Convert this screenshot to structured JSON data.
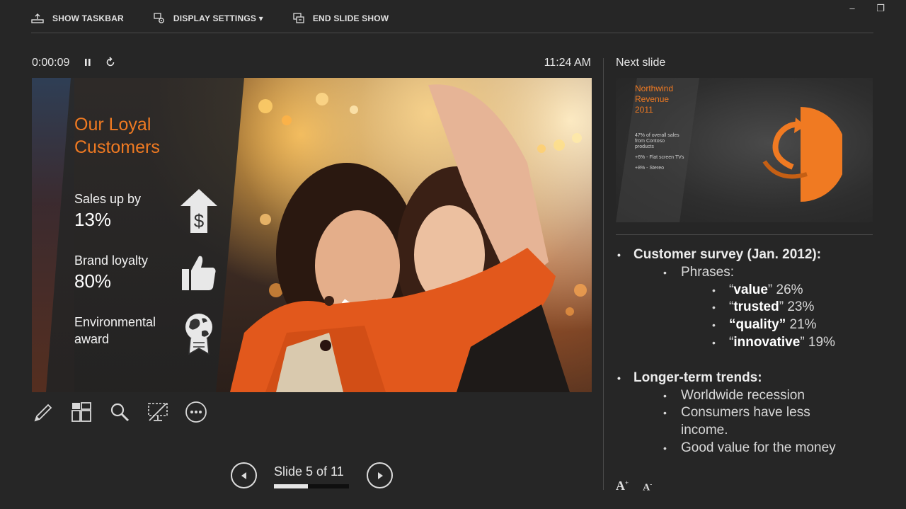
{
  "toolbar": {
    "show_taskbar": "SHOW TASKBAR",
    "display_settings": "DISPLAY SETTINGS ▾",
    "end_slide_show": "END SLIDE SHOW"
  },
  "window_controls": {
    "minimize": "–",
    "restore": "❐"
  },
  "status": {
    "elapsed": "0:00:09",
    "clock": "11:24 AM"
  },
  "slide": {
    "title": [
      "Our Loyal",
      "Customers"
    ],
    "stats": [
      {
        "label": "Sales up by",
        "value": "13%",
        "icon": "dollar-up-arrow-icon"
      },
      {
        "label": "Brand loyalty",
        "value": "80%",
        "icon": "thumbs-up-icon"
      },
      {
        "label": "Environmental",
        "label2": "award",
        "icon": "globe-ribbon-icon"
      }
    ]
  },
  "slide_tools": [
    "pen-icon",
    "see-all-slides-icon",
    "zoom-icon",
    "black-screen-icon",
    "more-options-icon"
  ],
  "navigation": {
    "counter": "Slide 5 of 11",
    "progress": 0.45
  },
  "next_slide": {
    "label": "Next slide",
    "title": [
      "Northwind",
      "Revenue",
      "2011"
    ],
    "body": [
      "47% of overall sales",
      "from Contoso",
      "products",
      "+6% - Flat screen TVs",
      "+8% - Stereo"
    ]
  },
  "notes": {
    "h1": "Customer survey (Jan. 2012):",
    "phrases": "Phrases:",
    "items": [
      {
        "word": "value",
        "pct": "26%"
      },
      {
        "word": "trusted",
        "pct": "23%"
      },
      {
        "word": "quality",
        "pct": "21%"
      },
      {
        "word": "innovative",
        "pct": "19%"
      }
    ],
    "h2": "Longer-term trends:",
    "trend1": "Worldwide recession",
    "trend2a": "Consumers have less",
    "trend2b": "income.",
    "trend3": "Good value for the money"
  },
  "font_buttons": {
    "larger": "A",
    "smaller": "A"
  },
  "colors": {
    "accent": "#f07a22",
    "background": "#262626"
  }
}
